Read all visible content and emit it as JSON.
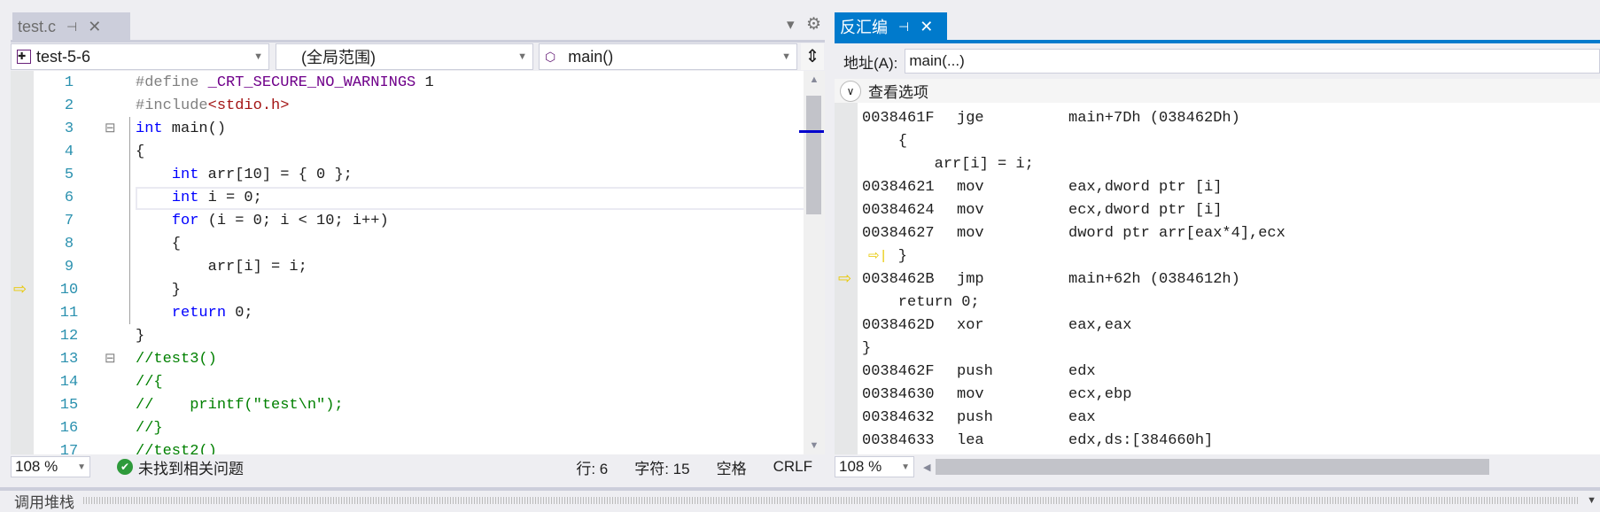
{
  "left_tab": {
    "title": "test.c",
    "pin": "⊣",
    "close": "✕"
  },
  "tab_tools": {
    "dropdown": "▾",
    "settings": "⚙"
  },
  "nav": {
    "project": "test-5-6",
    "scope": "(全局范围)",
    "member": "main()",
    "split": "⇕"
  },
  "code_lines": [
    {
      "n": "1",
      "t": [
        [
          "#define ",
          "pp"
        ],
        [
          "_CRT_SECURE_NO_WARNINGS",
          "mac"
        ],
        [
          " 1",
          ""
        ]
      ]
    },
    {
      "n": "2",
      "t": [
        [
          "#include",
          "pp"
        ],
        [
          "<stdio.h>",
          "str"
        ]
      ]
    },
    {
      "n": "3",
      "t": [
        [
          "int",
          "kw"
        ],
        [
          " main()",
          ""
        ]
      ],
      "fold": "⊟"
    },
    {
      "n": "4",
      "t": [
        [
          "{",
          ""
        ]
      ]
    },
    {
      "n": "5",
      "t": [
        [
          "    ",
          ""
        ],
        [
          "int",
          "kw"
        ],
        [
          " arr[10] = { 0 };",
          ""
        ]
      ]
    },
    {
      "n": "6",
      "t": [
        [
          "    ",
          ""
        ],
        [
          "int",
          "kw"
        ],
        [
          " i = 0;",
          ""
        ]
      ],
      "current": true
    },
    {
      "n": "7",
      "t": [
        [
          "    ",
          ""
        ],
        [
          "for",
          "kw"
        ],
        [
          " (i = 0; i < 10; i++)",
          ""
        ]
      ]
    },
    {
      "n": "8",
      "t": [
        [
          "    {",
          ""
        ]
      ]
    },
    {
      "n": "9",
      "t": [
        [
          "        arr[i] = i;",
          ""
        ]
      ]
    },
    {
      "n": "10",
      "t": [
        [
          "    }",
          ""
        ]
      ],
      "arrow": true
    },
    {
      "n": "11",
      "t": [
        [
          "    ",
          ""
        ],
        [
          "return",
          "kw"
        ],
        [
          " 0;",
          ""
        ]
      ]
    },
    {
      "n": "12",
      "t": [
        [
          "}",
          ""
        ]
      ]
    },
    {
      "n": "13",
      "t": [
        [
          "//test3()",
          "cm"
        ]
      ],
      "fold": "⊟"
    },
    {
      "n": "14",
      "t": [
        [
          "//{",
          "cm"
        ]
      ]
    },
    {
      "n": "15",
      "t": [
        [
          "//    printf(\"test\\n\");",
          "cm"
        ]
      ]
    },
    {
      "n": "16",
      "t": [
        [
          "//}",
          "cm"
        ]
      ]
    },
    {
      "n": "17",
      "t": [
        [
          "//test2()",
          "cm"
        ]
      ]
    }
  ],
  "left_status": {
    "zoom": "108 %",
    "issues": "未找到相关问题",
    "line": "行: 6",
    "char": "字符: 15",
    "spaces": "空格",
    "eol": "CRLF"
  },
  "disasm_tab": {
    "title": "反汇编",
    "pin": "⊣",
    "close": "✕"
  },
  "address": {
    "label": "地址(A):",
    "value": "main(...)"
  },
  "view_options": "查看选项",
  "disasm_lines": [
    {
      "addr": "0038461F",
      "mn": "jge",
      "op": "main+7Dh (038462Dh)"
    },
    {
      "src": "    {"
    },
    {
      "src": "        arr[i] = i;"
    },
    {
      "addr": "00384621",
      "mn": "mov",
      "op": "eax,dword ptr [i]"
    },
    {
      "addr": "00384624",
      "mn": "mov",
      "op": "ecx,dword ptr [i]"
    },
    {
      "addr": "00384627",
      "mn": "mov",
      "op": "dword ptr arr[eax*4],ecx"
    },
    {
      "src": "    }",
      "step": true
    },
    {
      "addr": "0038462B",
      "mn": "jmp",
      "op": "main+62h (0384612h)",
      "arrow": true
    },
    {
      "src": "    return 0;"
    },
    {
      "addr": "0038462D",
      "mn": "xor",
      "op": "eax,eax"
    },
    {
      "src": "}"
    },
    {
      "addr": "0038462F",
      "mn": "push",
      "op": "edx"
    },
    {
      "addr": "00384630",
      "mn": "mov",
      "op": "ecx,ebp"
    },
    {
      "addr": "00384632",
      "mn": "push",
      "op": "eax"
    },
    {
      "addr": "00384633",
      "mn": "lea",
      "op": "edx,ds:[384660h]"
    }
  ],
  "right_status": {
    "zoom": "108 %"
  },
  "bottom_panel": {
    "title": "调用堆栈"
  }
}
